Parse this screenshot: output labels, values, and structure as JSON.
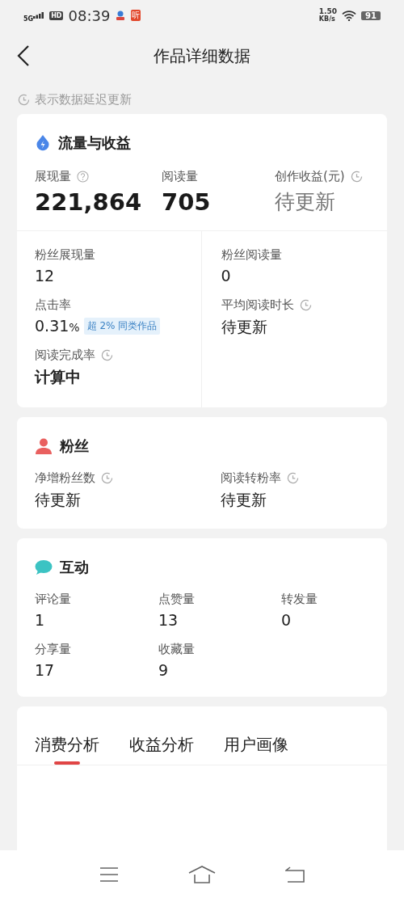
{
  "status_bar": {
    "network": "5G",
    "hd": "HD",
    "time": "08:39",
    "app_badge": "听",
    "speed": "1.50",
    "speed_unit": "KB/s",
    "battery": "91"
  },
  "header": {
    "title": "作品详细数据"
  },
  "note": "表示数据延迟更新",
  "sections": [
    {
      "kind": "traffic",
      "title": "流量与收益",
      "top": [
        {
          "label": "展现量",
          "kind": "help",
          "value": "221,864",
          "muted": false
        },
        {
          "label": "阅读量",
          "value": "705",
          "muted": false
        },
        {
          "label": "创作收益(元)",
          "kind": "delayed",
          "value": "待更新",
          "muted": true
        }
      ],
      "columns": [
        [
          {
            "label": "粉丝展现量",
            "value": "12"
          },
          {
            "label": "点击率",
            "value": "0.31",
            "unit": "%",
            "badge": "超 2% 同类作品"
          },
          {
            "label": "阅读完成率",
            "kind": "delayed",
            "value": "计算中",
            "strong": true
          }
        ],
        [
          {
            "label": "粉丝阅读量",
            "value": "0"
          },
          {
            "label": "平均阅读时长",
            "kind": "delayed",
            "value": "待更新"
          }
        ]
      ]
    },
    {
      "kind": "fans",
      "title": "粉丝",
      "grid": [
        {
          "label": "净增粉丝数",
          "kind": "delayed",
          "value": "待更新"
        },
        {
          "label": "阅读转粉率",
          "kind": "delayed",
          "value": "待更新"
        }
      ]
    },
    {
      "kind": "interaction",
      "title": "互动",
      "grid": [
        {
          "label": "评论量",
          "value": "1"
        },
        {
          "label": "点赞量",
          "value": "13"
        },
        {
          "label": "转发量",
          "value": "0"
        },
        {
          "label": "分享量",
          "value": "17"
        },
        {
          "label": "收藏量",
          "value": "9"
        }
      ]
    }
  ],
  "tabs": [
    {
      "label": "消费分析",
      "selected": true
    },
    {
      "label": "收益分析",
      "selected": false
    },
    {
      "label": "用户画像",
      "selected": false
    }
  ]
}
